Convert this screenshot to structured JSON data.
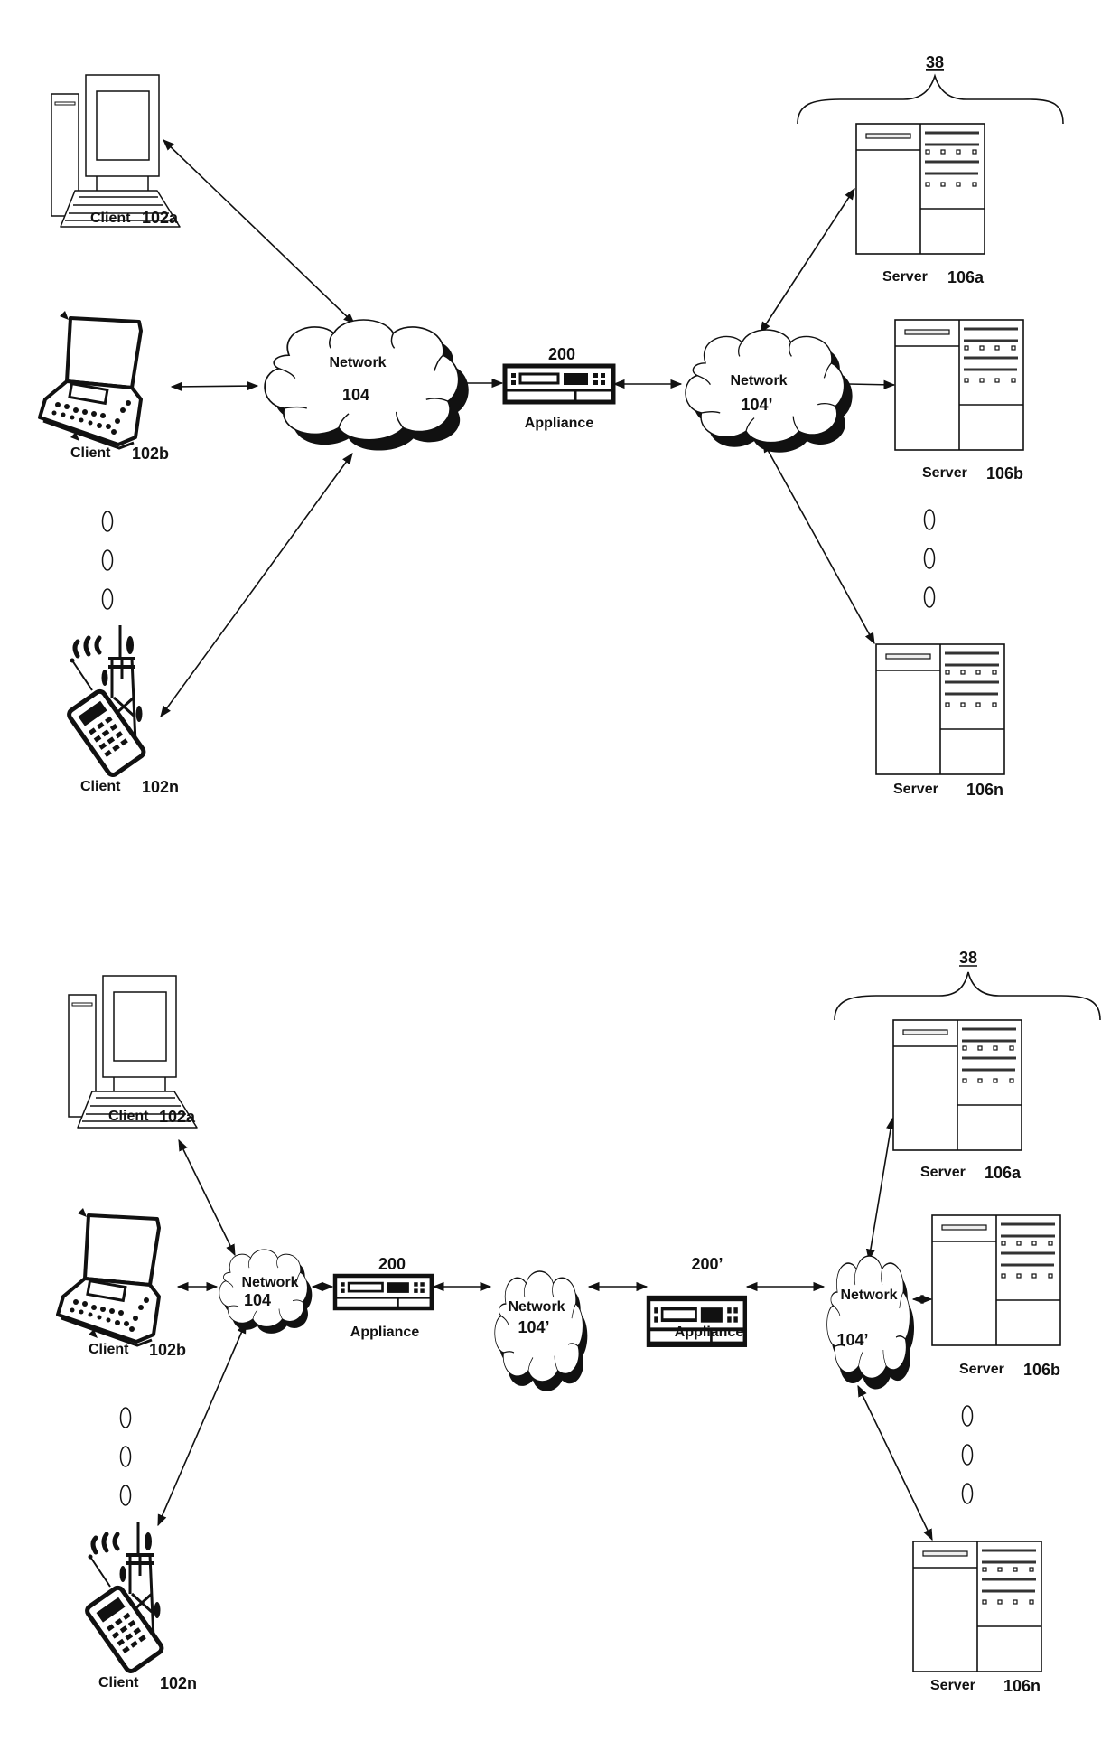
{
  "figures": [
    {
      "id": "fig-top",
      "group_label": "38",
      "clients": [
        {
          "type": "desktop",
          "label": "Client",
          "ref": "102a"
        },
        {
          "type": "laptop",
          "label": "Client",
          "ref": "102b"
        },
        {
          "type": "mobile",
          "label": "Client",
          "ref": "102n"
        }
      ],
      "networks": [
        {
          "label": "Network",
          "ref": "104"
        },
        {
          "label": "Network",
          "ref": "104’"
        }
      ],
      "appliances": [
        {
          "label": "Appliance",
          "ref": "200"
        }
      ],
      "servers": [
        {
          "label": "Server",
          "ref": "106a"
        },
        {
          "label": "Server",
          "ref": "106b"
        },
        {
          "label": "Server",
          "ref": "106n"
        }
      ]
    },
    {
      "id": "fig-bottom",
      "group_label": "38",
      "clients": [
        {
          "type": "desktop",
          "label": "Client",
          "ref": "102a"
        },
        {
          "type": "laptop",
          "label": "Client",
          "ref": "102b"
        },
        {
          "type": "mobile",
          "label": "Client",
          "ref": "102n"
        }
      ],
      "networks": [
        {
          "label": "Network",
          "ref": "104"
        },
        {
          "label": "Network",
          "ref": "104’"
        },
        {
          "label": "Network",
          "ref": "104’"
        }
      ],
      "appliances": [
        {
          "label": "Appliance",
          "ref": "200"
        },
        {
          "label": "Appliance",
          "ref": "200’"
        }
      ],
      "servers": [
        {
          "label": "Server",
          "ref": "106a"
        },
        {
          "label": "Server",
          "ref": "106b"
        },
        {
          "label": "Server",
          "ref": "106n"
        }
      ]
    }
  ],
  "icons": {
    "desktop": "desktop-computer-icon",
    "laptop": "laptop-icon",
    "mobile": "mobile-phone-tower-icon",
    "network": "cloud-icon",
    "appliance": "appliance-icon",
    "server": "server-icon",
    "ellipsis": "vertical-ellipsis-icon"
  }
}
